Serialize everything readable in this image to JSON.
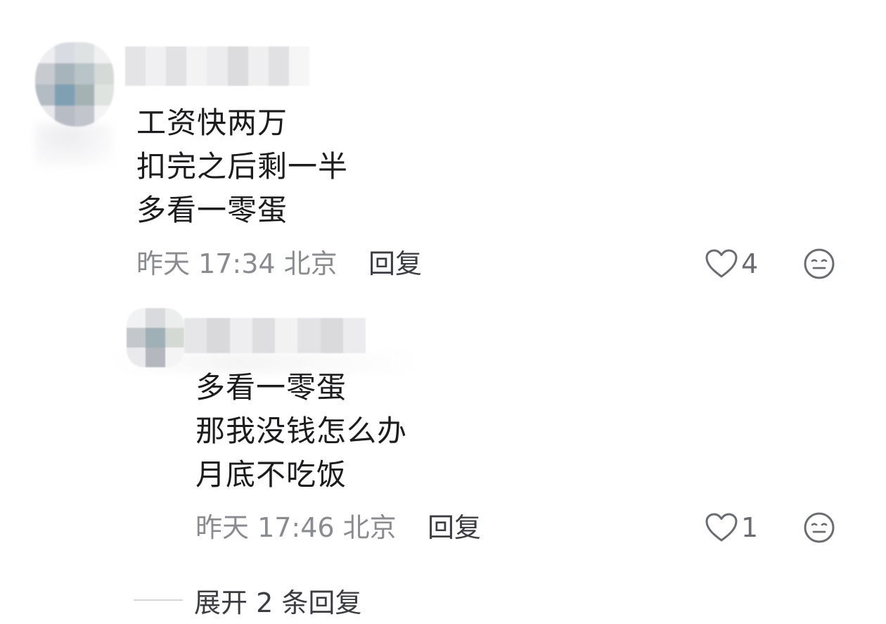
{
  "comments": [
    {
      "content_lines": [
        "工资快两万",
        "扣完之后剩一半",
        "多看一零蛋"
      ],
      "meta": "昨天 17:34 北京",
      "reply_label": "回复",
      "like_count": "4",
      "icons": {
        "like": "heart-outline-icon",
        "react": "neutral-face-icon"
      }
    },
    {
      "content_lines": [
        "多看一零蛋",
        "那我没钱怎么办",
        "月底不吃饭"
      ],
      "meta": "昨天 17:46 北京",
      "reply_label": "回复",
      "like_count": "1",
      "icons": {
        "like": "heart-outline-icon",
        "react": "neutral-face-icon"
      }
    }
  ],
  "expand_replies": {
    "label": "展开 2 条回复"
  },
  "colors": {
    "text": "#1c1c1e",
    "meta": "#8a8b91",
    "action": "#3c3d42"
  }
}
